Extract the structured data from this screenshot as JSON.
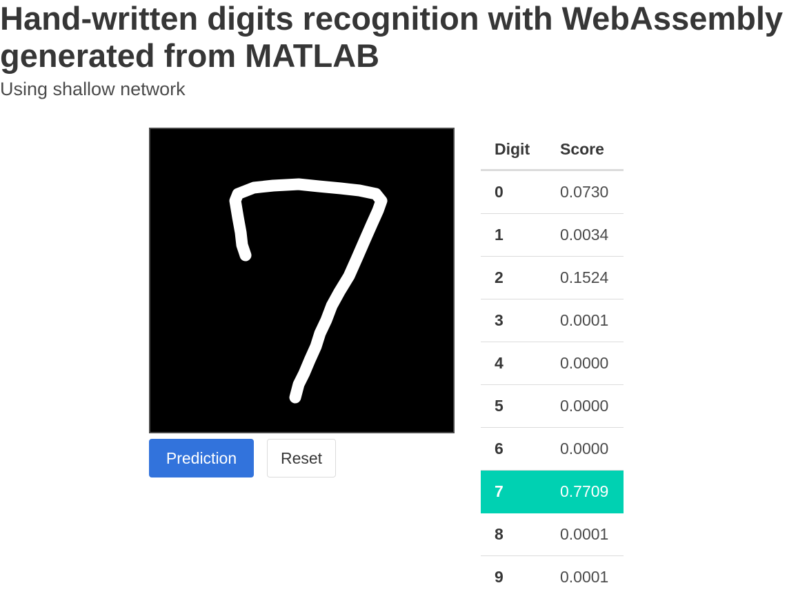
{
  "header": {
    "title": "Hand-written digits recognition with WebAssembly generated from MATLAB",
    "subtitle": "Using shallow network"
  },
  "canvas": {
    "drawn_digit": "7",
    "background_color": "#000000",
    "stroke_color": "#ffffff"
  },
  "buttons": {
    "prediction_label": "Prediction",
    "reset_label": "Reset",
    "primary_color": "#3273dc"
  },
  "table": {
    "headers": [
      "Digit",
      "Score"
    ],
    "highlight_color": "#00d1b2",
    "rows": [
      {
        "digit": "0",
        "score": "0.0730"
      },
      {
        "digit": "1",
        "score": "0.0034"
      },
      {
        "digit": "2",
        "score": "0.1524"
      },
      {
        "digit": "3",
        "score": "0.0001"
      },
      {
        "digit": "4",
        "score": "0.0000"
      },
      {
        "digit": "5",
        "score": "0.0000"
      },
      {
        "digit": "6",
        "score": "0.0000"
      },
      {
        "digit": "7",
        "score": "0.7709",
        "selected": true
      },
      {
        "digit": "8",
        "score": "0.0001"
      },
      {
        "digit": "9",
        "score": "0.0001"
      }
    ]
  }
}
